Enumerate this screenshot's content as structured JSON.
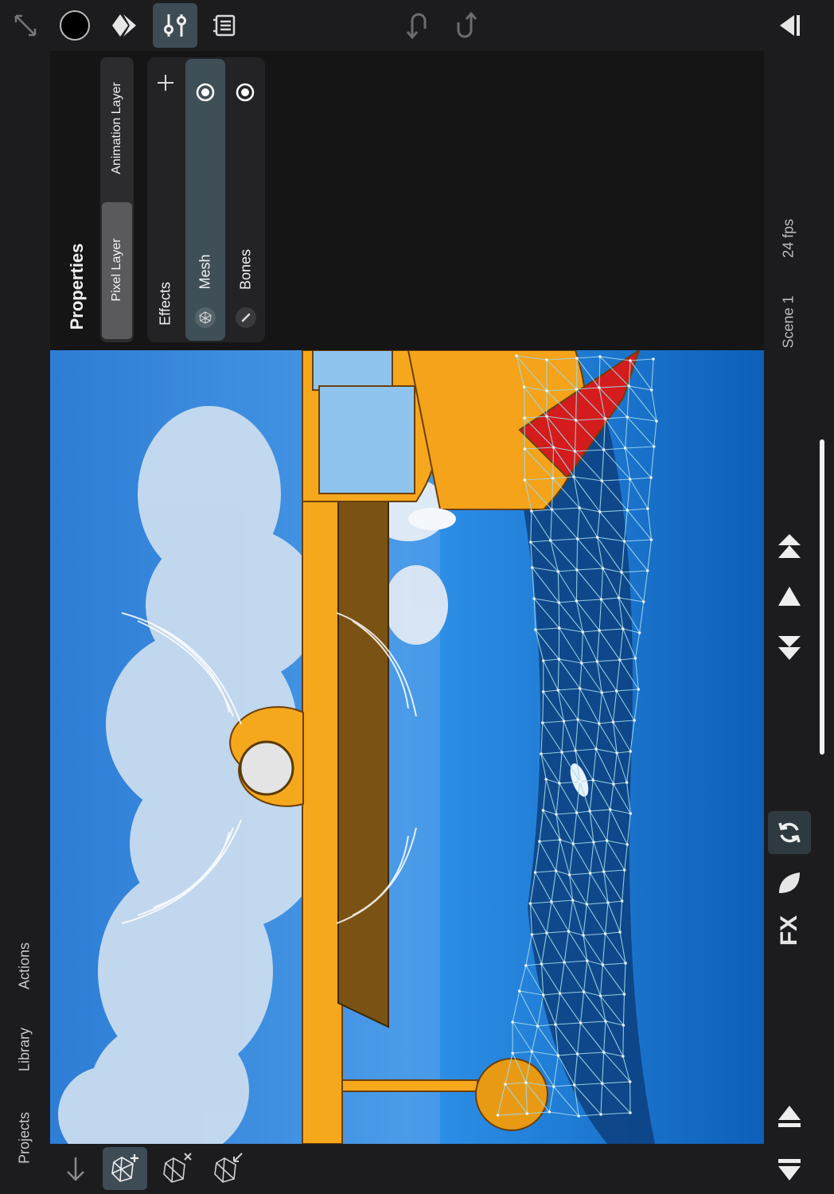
{
  "top_toolbar": {
    "expand": "expand-icon",
    "color_swatch": "#000000",
    "undo": "undo-icon",
    "redo": "redo-icon"
  },
  "properties": {
    "title": "Properties",
    "layer_types": [
      "Pixel Layer",
      "Animation Layer"
    ],
    "selected_layer_type": "Pixel Layer",
    "effects_label": "Effects",
    "effects": [
      {
        "name": "Mesh",
        "selected": true,
        "icon": "mesh-icon"
      },
      {
        "name": "Bones",
        "selected": false,
        "icon": "bone-icon"
      }
    ]
  },
  "right_panel": {
    "scene": "Scene 1",
    "fps": "24 fps",
    "fx_label": "FX"
  },
  "left_panel": {
    "tabs": [
      "Actions",
      "Library",
      "Projects"
    ]
  },
  "colors": {
    "accent": "#3d4c55",
    "background": "#1c1c1e",
    "sky": "#2a80d8",
    "hull": "#f6a81d",
    "mesh": "#9fd9e8"
  }
}
